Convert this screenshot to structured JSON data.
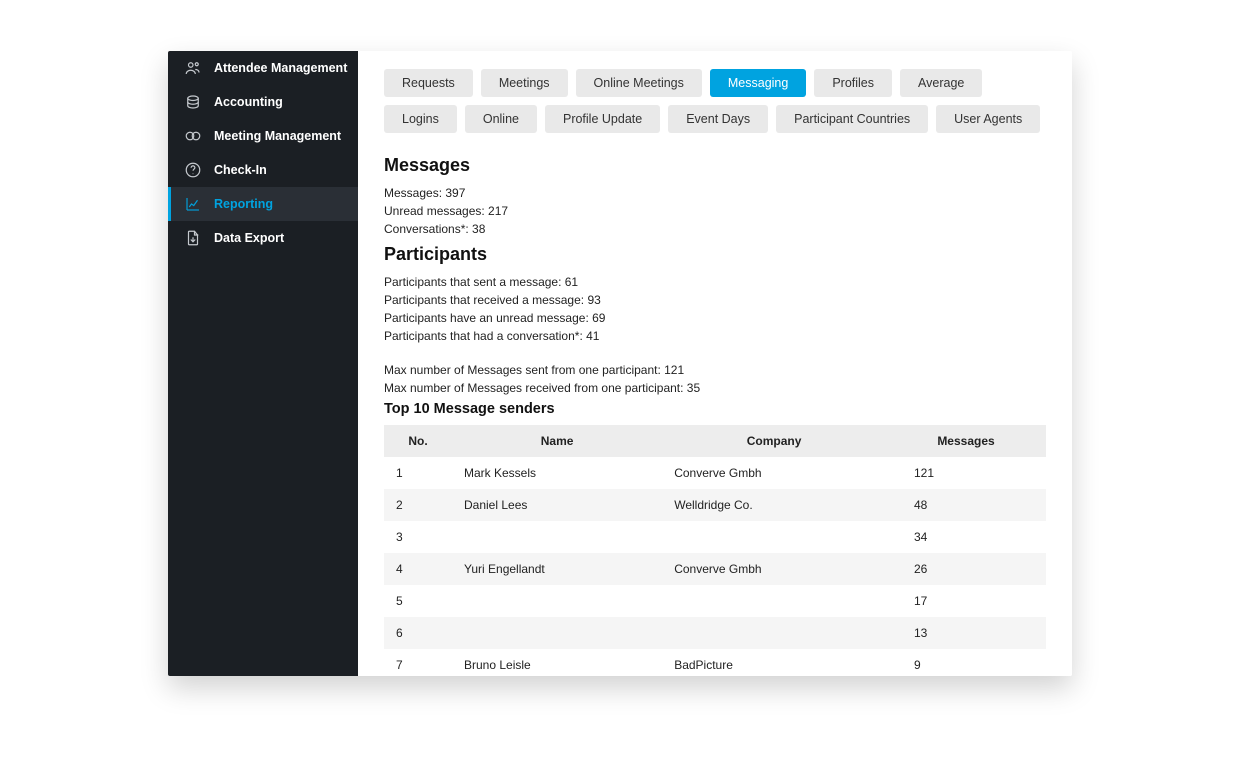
{
  "sidebar": {
    "items": [
      {
        "label": "Attendee Management",
        "icon": "users-icon",
        "active": false
      },
      {
        "label": "Accounting",
        "icon": "coins-icon",
        "active": false
      },
      {
        "label": "Meeting Management",
        "icon": "link-icon",
        "active": false
      },
      {
        "label": "Check-In",
        "icon": "help-icon",
        "active": false
      },
      {
        "label": "Reporting",
        "icon": "chart-icon",
        "active": true
      },
      {
        "label": "Data Export",
        "icon": "export-icon",
        "active": false
      }
    ]
  },
  "tabs_row1": [
    {
      "label": "Requests",
      "active": false
    },
    {
      "label": "Meetings",
      "active": false
    },
    {
      "label": "Online Meetings",
      "active": false
    },
    {
      "label": "Messaging",
      "active": true
    },
    {
      "label": "Profiles",
      "active": false
    },
    {
      "label": "Average",
      "active": false
    },
    {
      "label": "Logins",
      "active": false
    }
  ],
  "tabs_row2": [
    {
      "label": "Online",
      "active": false
    },
    {
      "label": "Profile Update",
      "active": false
    },
    {
      "label": "Event Days",
      "active": false
    },
    {
      "label": "Participant Countries",
      "active": false
    },
    {
      "label": "User Agents",
      "active": false
    }
  ],
  "messages_section": {
    "heading": "Messages",
    "lines": [
      "Messages: 397",
      "Unread messages: 217",
      "Conversations*: 38"
    ]
  },
  "participants_section": {
    "heading": "Participants",
    "lines": [
      "Participants that sent a message: 61",
      "Participants that received a message: 93",
      "Participants have an unread message: 69",
      "Participants that had a conversation*: 41"
    ],
    "max_lines": [
      "Max number of Messages sent from one participant: 121",
      "Max number of Messages received from one participant: 35"
    ]
  },
  "top10": {
    "heading": "Top 10 Message senders",
    "columns": {
      "no": "No.",
      "name": "Name",
      "company": "Company",
      "messages": "Messages"
    },
    "rows": [
      {
        "no": "1",
        "name": "Mark Kessels",
        "company": "Converve Gmbh",
        "messages": "121"
      },
      {
        "no": "2",
        "name": "Daniel Lees",
        "company": "Welldridge Co.",
        "messages": "48"
      },
      {
        "no": "3",
        "name": "",
        "company": "",
        "messages": "34"
      },
      {
        "no": "4",
        "name": "Yuri Engellandt",
        "company": "Converve Gmbh",
        "messages": "26"
      },
      {
        "no": "5",
        "name": "",
        "company": "",
        "messages": "17"
      },
      {
        "no": "6",
        "name": "",
        "company": "",
        "messages": "13"
      },
      {
        "no": "7",
        "name": "Bruno Leisle",
        "company": "BadPicture",
        "messages": "9"
      }
    ]
  }
}
